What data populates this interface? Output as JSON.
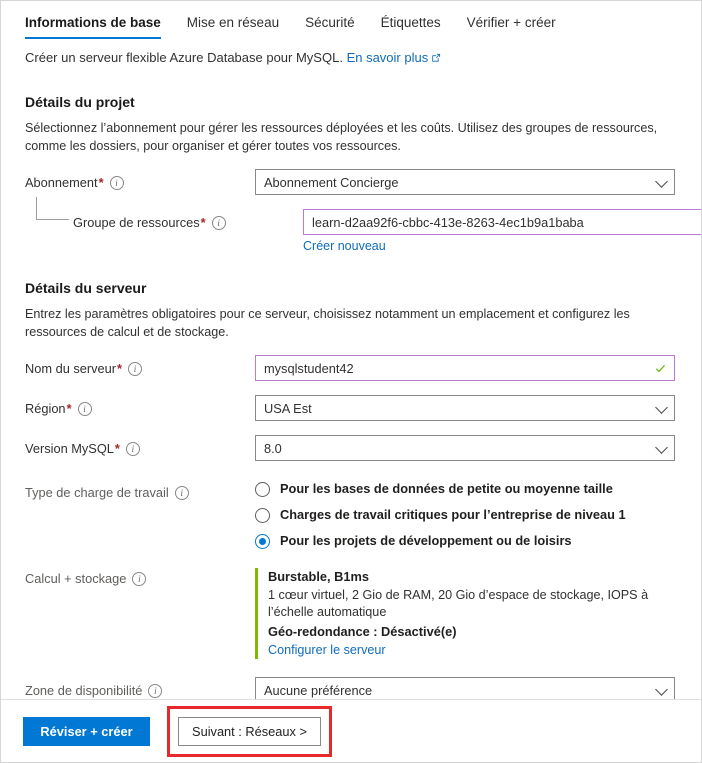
{
  "tabs": [
    {
      "label": "Informations de base",
      "active": true
    },
    {
      "label": "Mise en réseau",
      "active": false
    },
    {
      "label": "Sécurité",
      "active": false
    },
    {
      "label": "Étiquettes",
      "active": false
    },
    {
      "label": "Vérifier + créer",
      "active": false
    }
  ],
  "intro": {
    "text": "Créer un serveur flexible Azure Database pour MySQL.",
    "link_label": "En savoir plus",
    "link_icon": "external-link-icon"
  },
  "project": {
    "title": "Détails du projet",
    "description": "Sélectionnez l’abonnement pour gérer les ressources déployées et les coûts. Utilisez des groupes de ressources, comme les dossiers, pour organiser et gérer toutes vos ressources.",
    "subscription": {
      "label": "Abonnement",
      "required": "*",
      "info_icon": "info-icon",
      "value": "Abonnement Concierge",
      "chevron_icon": "chevron-down-icon"
    },
    "resource_group": {
      "label": "Groupe de ressources",
      "required": "*",
      "info_icon": "info-icon",
      "value": "learn-d2aa92f6-cbbc-413e-8263-4ec1b9a1baba",
      "chevron_icon": "chevron-down-icon",
      "create_new_label": "Créer nouveau"
    }
  },
  "server": {
    "title": "Détails du serveur",
    "description": "Entrez les paramètres obligatoires pour ce serveur, choisissez notamment un emplacement et configurez les ressources de calcul et de stockage.",
    "server_name": {
      "label": "Nom du serveur",
      "required": "*",
      "info_icon": "info-icon",
      "value": "mysqlstudent42",
      "valid_icon": "checkmark-icon"
    },
    "region": {
      "label": "Région",
      "required": "*",
      "info_icon": "info-icon",
      "value": "USA Est",
      "chevron_icon": "chevron-down-icon"
    },
    "mysql_version": {
      "label": "Version MySQL",
      "required": "*",
      "info_icon": "info-icon",
      "value": "8.0",
      "chevron_icon": "chevron-down-icon"
    },
    "workload_type": {
      "label": "Type de charge de travail",
      "info_icon": "info-icon",
      "options": [
        {
          "label": "Pour les bases de données de petite ou moyenne taille",
          "selected": false
        },
        {
          "label": "Charges de travail critiques pour l’entreprise de niveau 1",
          "selected": false
        },
        {
          "label": "Pour les projets de développement ou de loisirs",
          "selected": true
        }
      ]
    },
    "compute_storage": {
      "label": "Calcul + stockage",
      "info_icon": "info-icon",
      "tier": "Burstable, B1ms",
      "details": "1 cœur virtuel, 2 Gio de RAM, 20 Gio d’espace de stockage, IOPS à l’échelle automatique",
      "geo_redundancy": "Géo-redondance : Désactivé(e)",
      "configure_link": "Configurer le serveur",
      "accent_color": "#7fba00"
    },
    "availability_zone": {
      "label": "Zone de disponibilité",
      "info_icon": "info-icon",
      "value": "Aucune préférence",
      "chevron_icon": "chevron-down-icon"
    }
  },
  "footer": {
    "review_create_label": "Réviser + créer",
    "next_label": "Suivant : Réseaux  >",
    "highlight_color": "#e8292b",
    "primary_color": "#0078d4"
  }
}
